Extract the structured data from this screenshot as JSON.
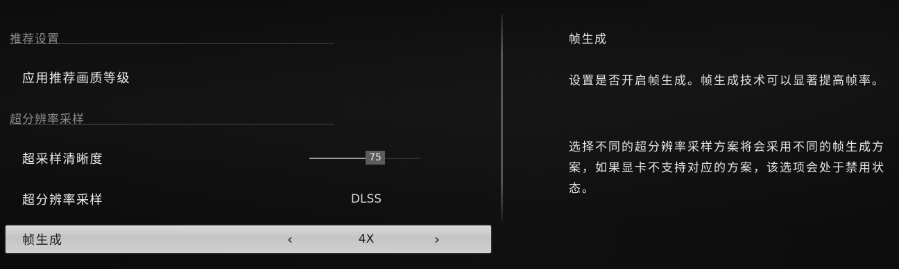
{
  "settings": {
    "section_recommended": "推荐设置",
    "apply_recommended_label": "应用推荐画质等级",
    "section_upscaling": "超分辨率采样",
    "sharpness_label": "超采样清晰度",
    "sharpness_value": "75",
    "sharpness_fraction": 0.6,
    "upscaling_label": "超分辨率采样",
    "upscaling_value": "DLSS",
    "frame_gen_label": "帧生成",
    "frame_gen_value": "4X"
  },
  "description": {
    "title": "帧生成",
    "para1": "设置是否开启帧生成。帧生成技术可以显著提高帧率。",
    "para2": "选择不同的超分辨率采样方案将会采用不同的帧生成方案，如果显卡不支持对应的方案，该选项会处于禁用状态。"
  },
  "icons": {
    "prev": "chevron-left-icon",
    "next": "chevron-right-icon"
  }
}
